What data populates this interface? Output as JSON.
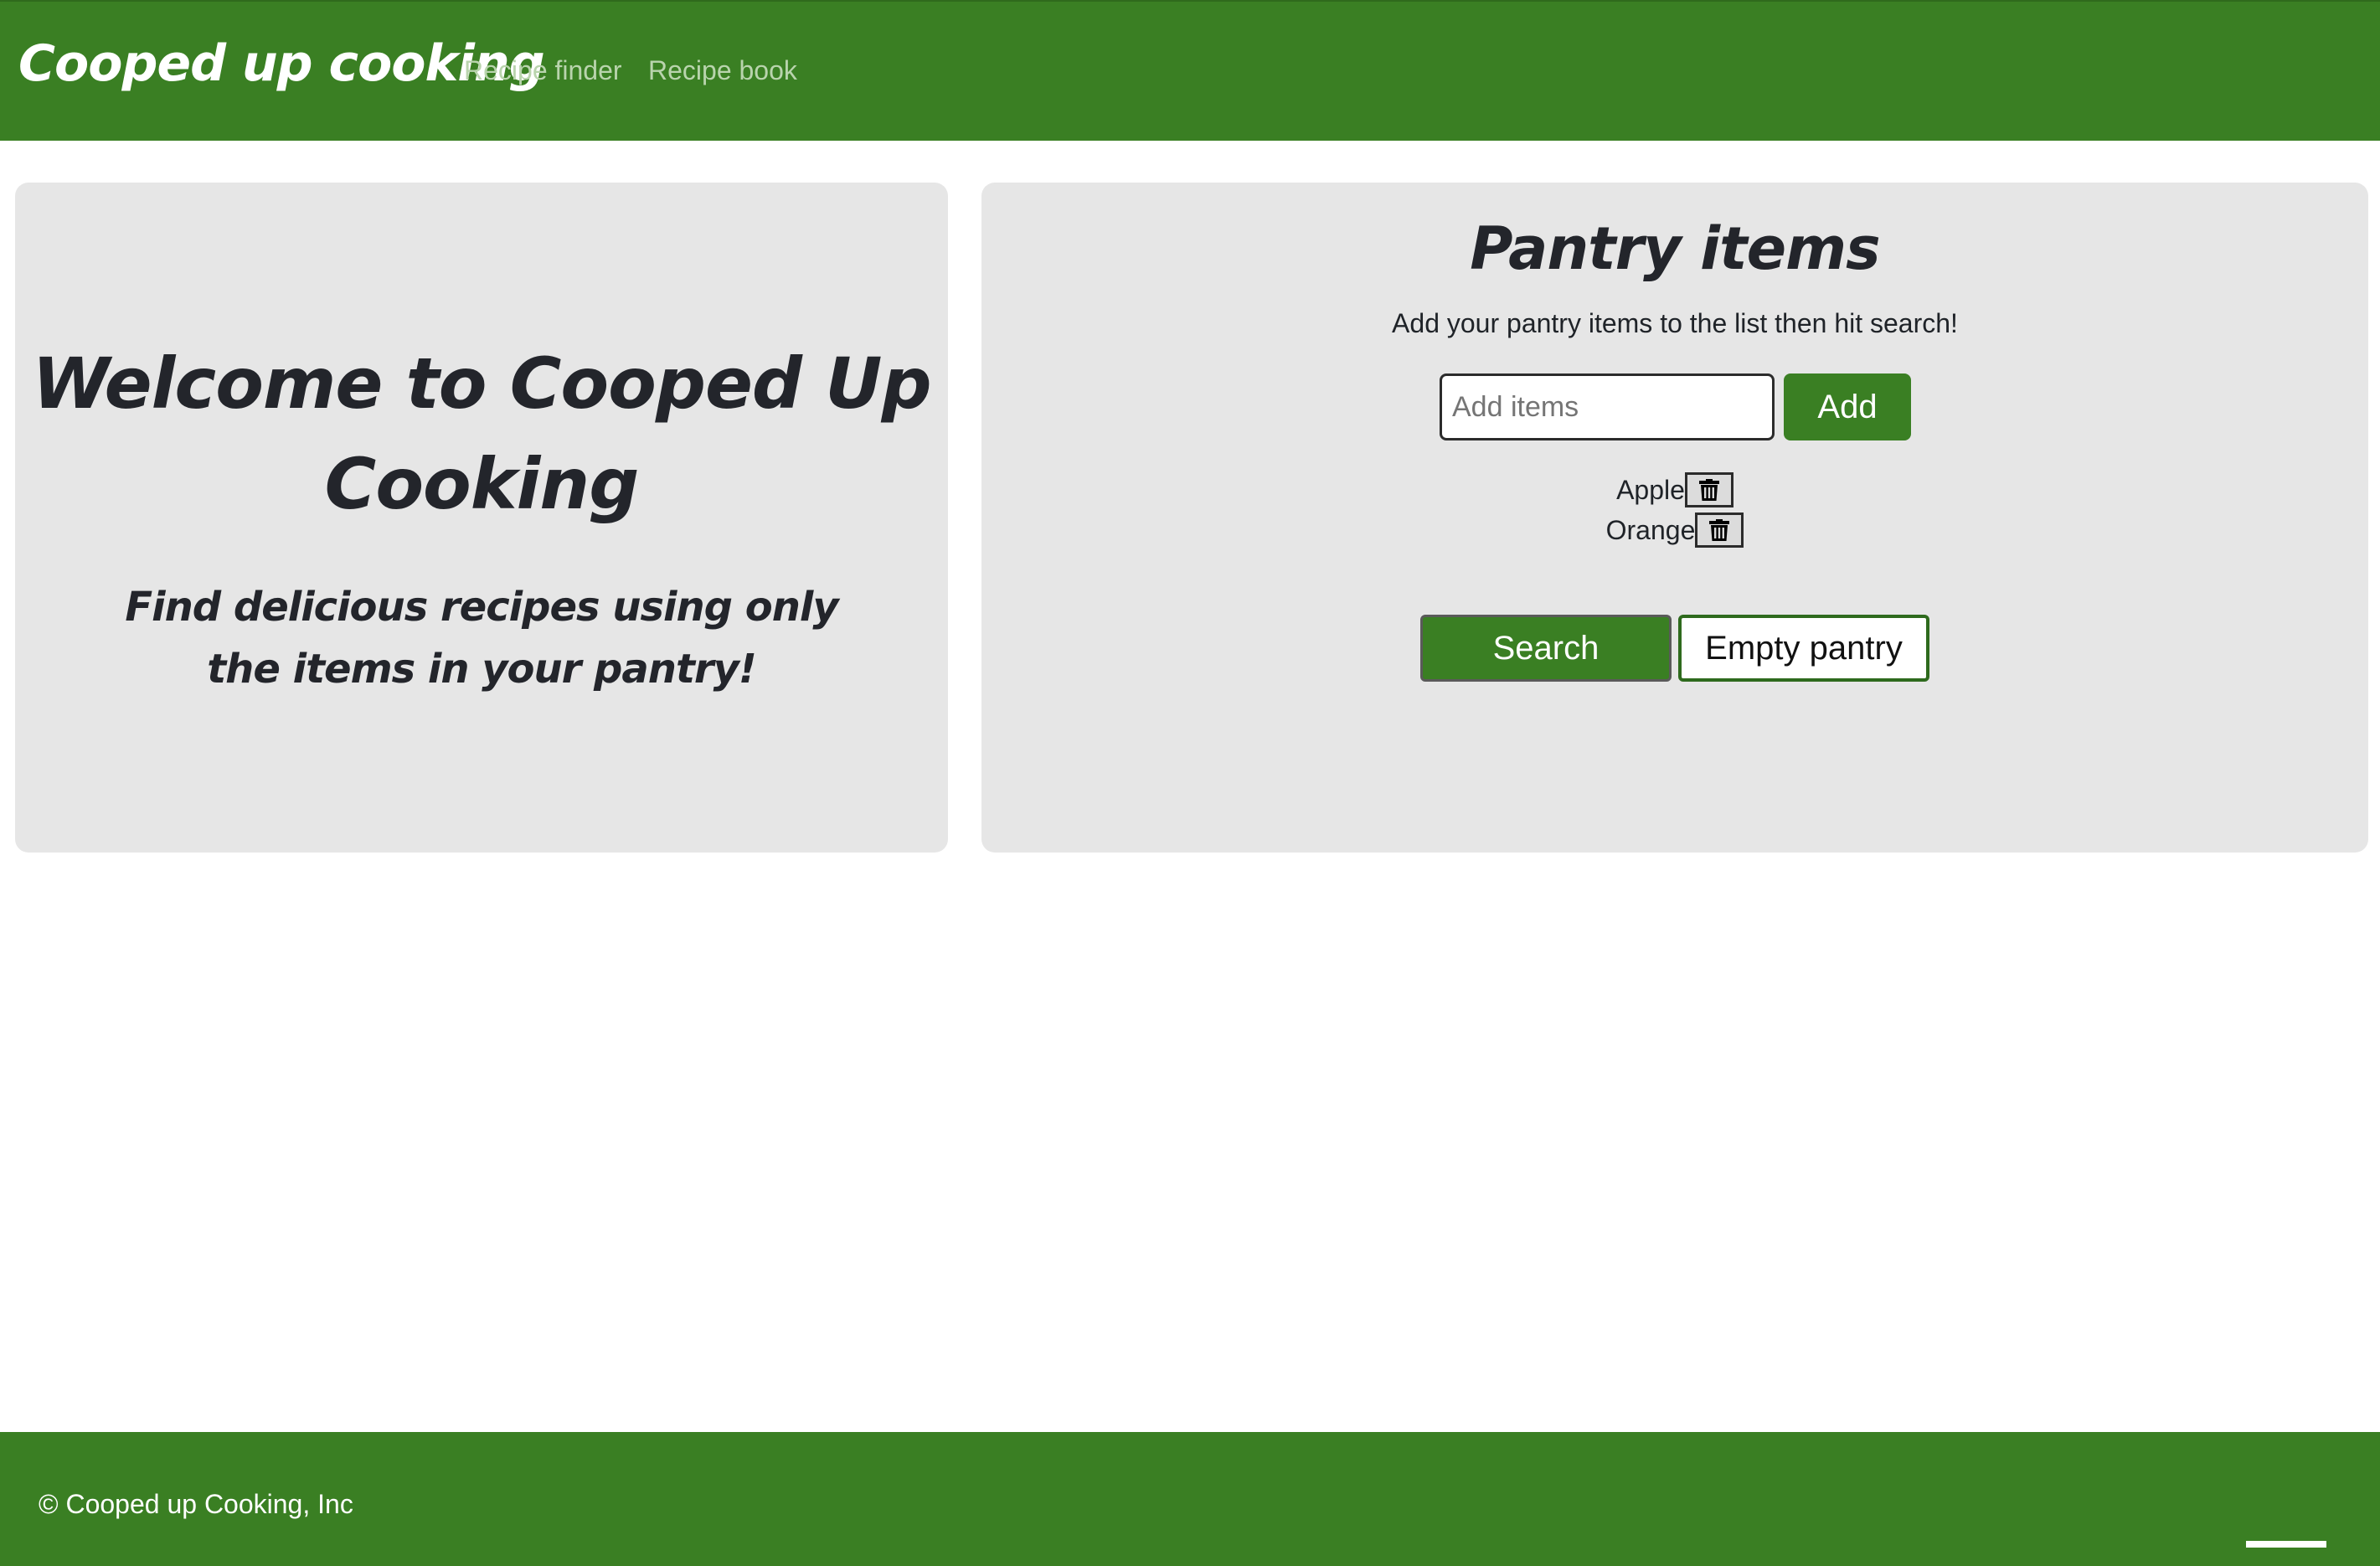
{
  "header": {
    "brand": "Cooped up cooking",
    "nav": [
      {
        "label": "Recipe finder"
      },
      {
        "label": "Recipe book"
      }
    ]
  },
  "welcome": {
    "title_line1": "Welcome to Cooped Up",
    "title_line2": "Cooking",
    "subtitle": "Find delicious recipes using only the items in your pantry!"
  },
  "pantry": {
    "title": "Pantry items",
    "description": "Add your pantry items to the list then hit search!",
    "input_placeholder": "Add items",
    "input_value": "",
    "add_label": "Add",
    "items": [
      {
        "label": "Apple",
        "delete_icon": "trash-icon"
      },
      {
        "label": "Orange",
        "delete_icon": "trash-icon"
      }
    ],
    "search_label": "Search",
    "empty_label": "Empty pantry"
  },
  "footer": {
    "copyright": "© Cooped up Cooking, Inc"
  },
  "colors": {
    "brand_green": "#3a7f23",
    "card_gray": "#e6e6e6",
    "nav_link": "#b9d4ad"
  }
}
